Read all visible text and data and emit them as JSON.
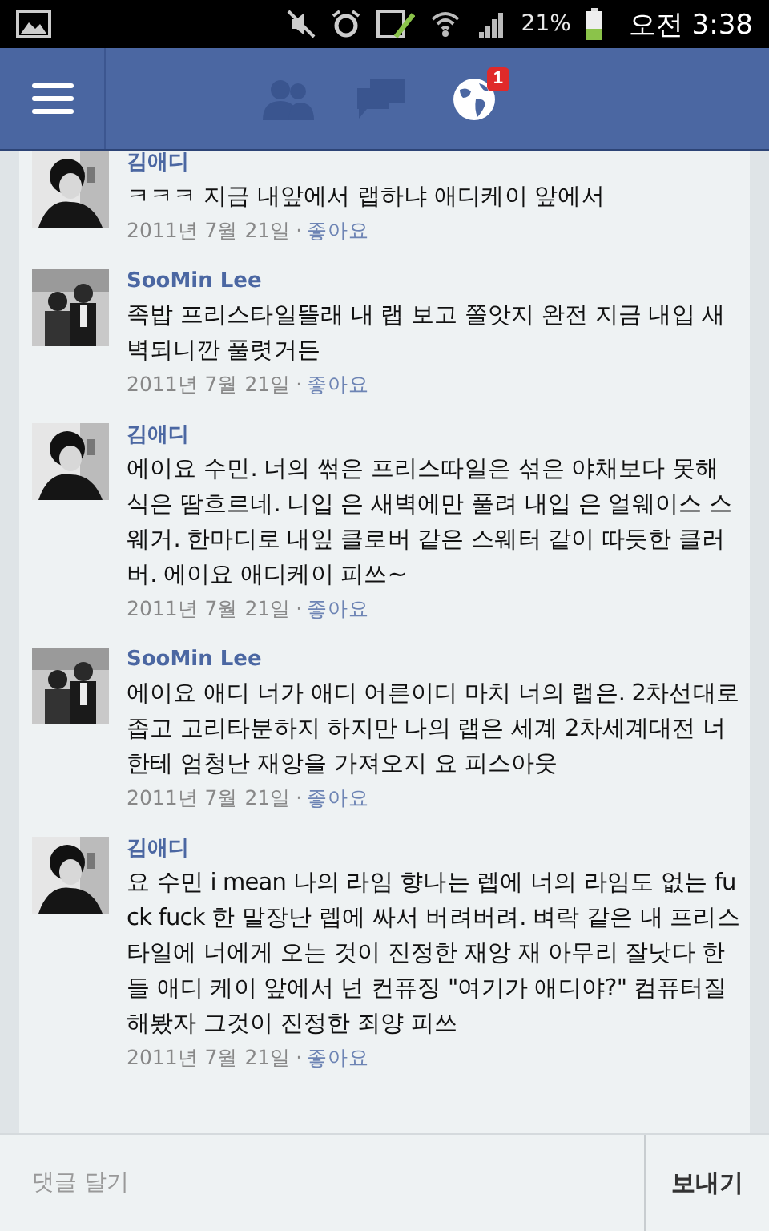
{
  "status_bar": {
    "battery_text": "21%",
    "time": "오전 3:38"
  },
  "nav": [
    {
      "kind": "friends",
      "highlighted": false
    },
    {
      "kind": "messages",
      "highlighted": false
    },
    {
      "kind": "notifications",
      "highlighted": true,
      "badge": "1"
    }
  ],
  "comments": [
    {
      "author": "김애디",
      "text": "ㅋㅋㅋ 지금 내앞에서 랩하냐 애디케이 앞에서",
      "date": "2011년 7월 21일",
      "separator": "·",
      "like": "좋아요",
      "kind": "picture"
    },
    {
      "author": "SooMin Lee",
      "text": "족밥 프리스타일뜰래 내 랩 보고 쫄앗지 완전 지금 내입 새벽되니깐 풀렷거든",
      "date": "2011년 7월 21일",
      "separator": "·",
      "like": "좋아요",
      "kind": "picture"
    },
    {
      "author": "김애디",
      "text": "에이요 수민. 너의 썪은 프리스따일은 섞은 야채보다 못해 식은 땀흐르네. 니입 은 새벽에만 풀려 내입 은 얼웨이스 스웨거. 한마디로 내잎 클로버 같은 스웨터 같이 따듯한 클러버. 에이요 애디케이 피쓰~",
      "date": "2011년 7월 21일",
      "separator": "·",
      "like": "좋아요",
      "kind": "picture"
    },
    {
      "author": "SooMin Lee",
      "text": "에이요 애디 너가 애디 어른이디 마치 너의 랩은. 2차선대로 좁고 고리타분하지 하지만 나의 랩은 세계 2차세계대전 너한테 엄청난 재앙을 가져오지 요 피스아웃",
      "date": "2011년 7월 21일",
      "separator": "·",
      "like": "좋아요",
      "kind": "picture"
    },
    {
      "author": "김애디",
      "text": "요 수민 i mean 나의 라임 향나는 렙에 너의 라임도 없는 fuck fuck 한 말장난 렙에 싸서 버려버려. 벼락 같은 내 프리스타일에 너에게 오는 것이 진정한 재앙 재 아무리 잘낫다 한들 애디 케이 앞에서 넌 컨퓨징 \"여기가 애디야?\" 컴퓨터질 해봤자 그것이 진정한 죄양 피쓰",
      "date": "2011년 7월 21일",
      "separator": "·",
      "like": "좋아요",
      "kind": "picture"
    }
  ],
  "composer": {
    "placeholder": "댓글 달기",
    "send": "보내기"
  }
}
